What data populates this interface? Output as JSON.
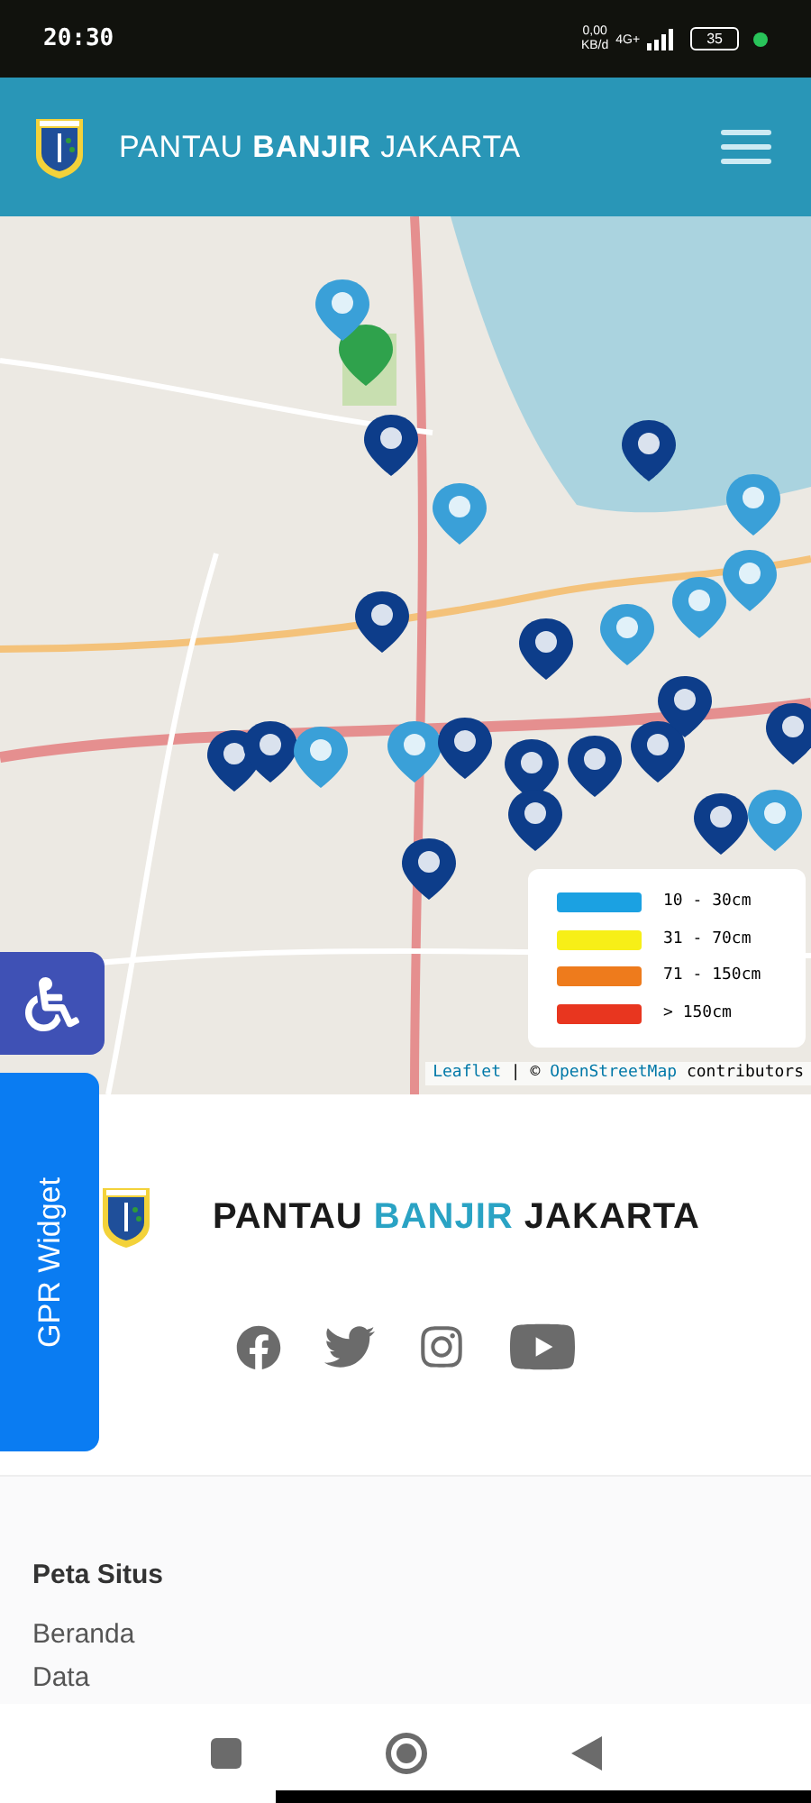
{
  "status_bar": {
    "time": "20:30",
    "data_rate": "0,00",
    "data_unit": "KB/d",
    "network": "4G+",
    "battery": "35"
  },
  "header": {
    "title_start": "PANTAU ",
    "title_bold": "BANJIR",
    "title_end": " JAKARTA"
  },
  "map": {
    "legend": [
      {
        "label": "10 - 30cm",
        "color": "#1ba1e2"
      },
      {
        "label": "31 - 70cm",
        "color": "#f7ef17"
      },
      {
        "label": "71 - 150cm",
        "color": "#ee7b1c"
      },
      {
        "label": "> 150cm",
        "color": "#e8361f"
      }
    ],
    "attribution": {
      "link_1": "Leaflet",
      "separator": " | © ",
      "link_2": "OpenStreetMap",
      "suffix": " contributors"
    }
  },
  "widget_tab": "GPR Widget",
  "footer": {
    "title_start": "PANTAU ",
    "title_accent": "BANJIR",
    "title_end": " JAKARTA"
  },
  "sitemap": {
    "heading": "Peta Situs",
    "links": [
      "Beranda",
      "Data"
    ]
  }
}
